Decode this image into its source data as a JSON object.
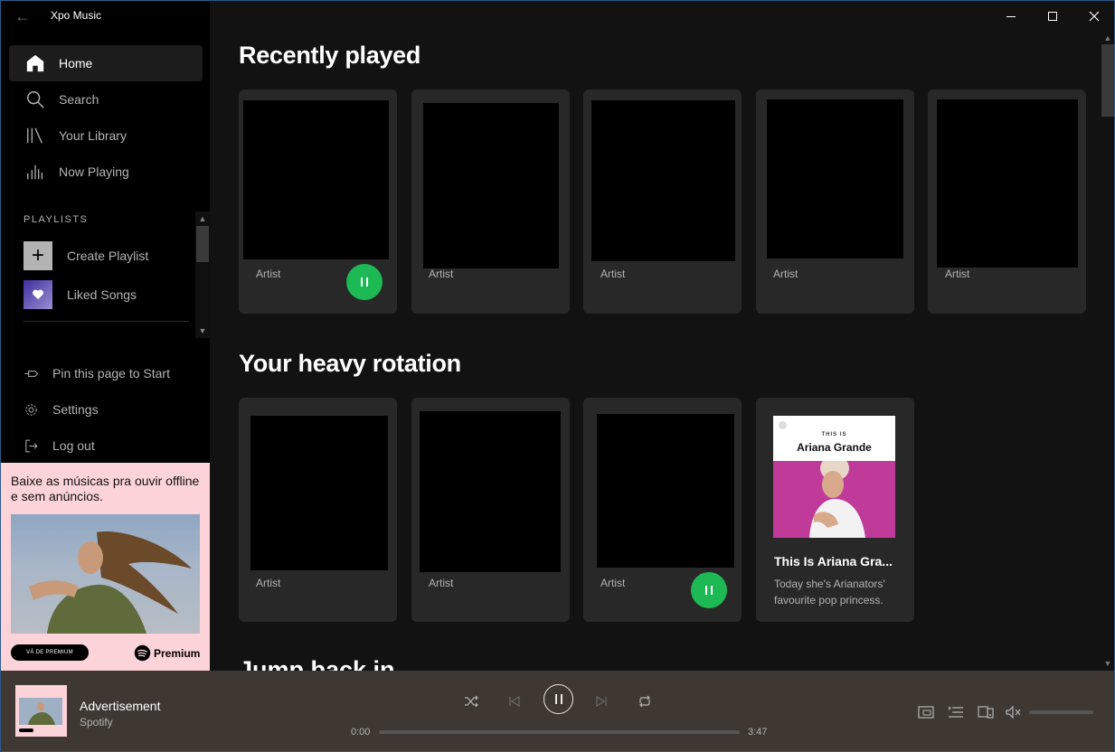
{
  "window": {
    "title": "Xpo Music"
  },
  "sidebar": {
    "nav": [
      {
        "label": "Home",
        "icon": "home-icon",
        "active": true
      },
      {
        "label": "Search",
        "icon": "search-icon"
      },
      {
        "label": "Your Library",
        "icon": "library-icon"
      },
      {
        "label": "Now Playing",
        "icon": "now-playing-icon"
      }
    ],
    "playlists_label": "PLAYLISTS",
    "playlists": [
      {
        "label": "Create Playlist",
        "icon": "plus-icon"
      },
      {
        "label": "Liked Songs",
        "icon": "heart-icon"
      }
    ],
    "bottom": [
      {
        "label": "Pin this page to Start",
        "icon": "pin-icon"
      },
      {
        "label": "Settings",
        "icon": "gear-icon"
      },
      {
        "label": "Log out",
        "icon": "logout-icon"
      }
    ],
    "ad": {
      "text": "Baixe as músicas pra ouvir offline e sem anúncios.",
      "button": "VÁ DE PREMIUM",
      "brand": "Premium"
    }
  },
  "main": {
    "sections": [
      {
        "title": "Recently played",
        "cards": [
          {
            "subtitle": "Artist",
            "playing": true
          },
          {
            "subtitle": "Artist"
          },
          {
            "subtitle": "Artist"
          },
          {
            "subtitle": "Artist"
          },
          {
            "subtitle": "Artist"
          }
        ]
      },
      {
        "title": "Your heavy rotation",
        "cards": [
          {
            "subtitle": "Artist"
          },
          {
            "subtitle": "Artist"
          },
          {
            "subtitle": "Artist",
            "playing": true
          },
          {
            "cover_label_small": "THIS IS",
            "cover_label_name": "Ariana Grande",
            "title": "This Is Ariana Gra...",
            "description": "Today she's Arianators' favourite pop princess."
          }
        ]
      }
    ],
    "partial_heading": "Jump back in"
  },
  "player": {
    "title": "Advertisement",
    "artist": "Spotify",
    "elapsed": "0:00",
    "duration": "3:47",
    "progress": 0,
    "volume": 0,
    "muted": true,
    "state": "playing"
  },
  "colors": {
    "accent": "#1db954",
    "sidebar_bg": "#000000",
    "main_bg": "#121212",
    "card_bg": "#282828",
    "player_bg": "#3f3832",
    "ad_bg": "#fbd3d8"
  }
}
